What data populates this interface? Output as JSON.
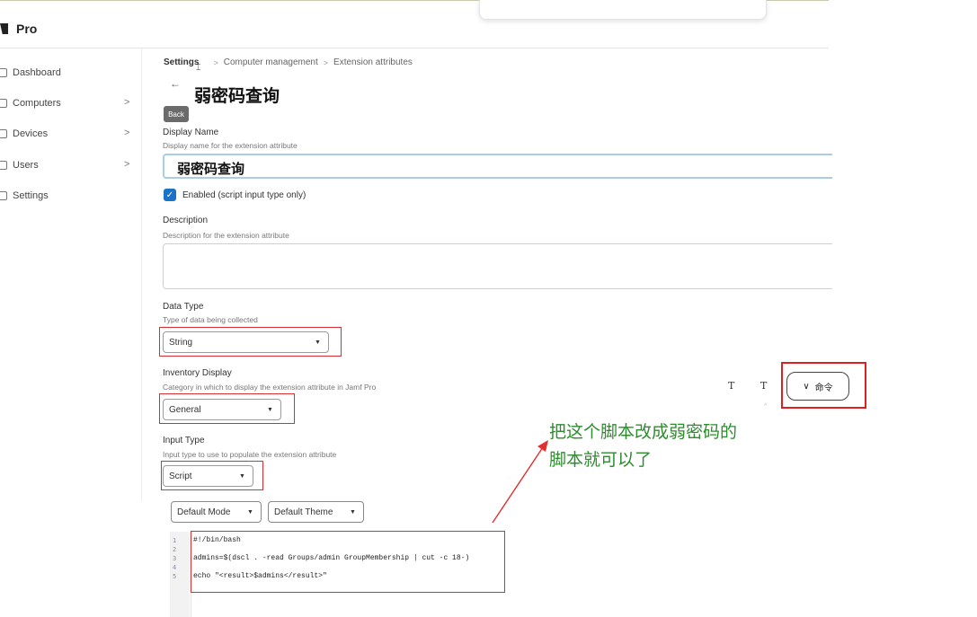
{
  "app": {
    "brand": "Pro"
  },
  "sidebar": {
    "items": [
      {
        "label": "Dashboard",
        "has_chevron": false,
        "chevron": ""
      },
      {
        "label": "Computers",
        "has_chevron": true,
        "chevron": ">"
      },
      {
        "label": "Devices",
        "has_chevron": true,
        "chevron": ">"
      },
      {
        "label": "Users",
        "has_chevron": true,
        "chevron": ">"
      },
      {
        "label": "Settings",
        "has_chevron": false,
        "chevron": ""
      }
    ]
  },
  "breadcrumb": {
    "items": [
      "Settings",
      "Computer management",
      "Extension attributes"
    ],
    "separator": ">"
  },
  "header": {
    "back_arrow": "←",
    "back_tooltip": "Back",
    "title": "弱密码查询"
  },
  "form": {
    "display_name": {
      "label": "Display Name",
      "hint": "Display name for the extension attribute",
      "value": "弱密码查询"
    },
    "enabled": {
      "checked": true,
      "label": "Enabled (script input type only)"
    },
    "description": {
      "label": "Description",
      "hint": "Description for the extension attribute",
      "value": ""
    },
    "data_type": {
      "label": "Data Type",
      "hint": "Type of data being collected",
      "value": "String"
    },
    "inventory_display": {
      "label": "Inventory Display",
      "hint": "Category in which to display the extension attribute in Jamf Pro",
      "value": "General"
    },
    "input_type": {
      "label": "Input Type",
      "hint": "Input type to use to populate the extension attribute",
      "value": "Script"
    }
  },
  "editor": {
    "mode": "Default Mode",
    "theme": "Default Theme",
    "line_numbers": [
      "1",
      "2",
      "3",
      "4",
      "5"
    ],
    "lines": [
      "#!/bin/bash",
      "",
      "admins=$(dscl . -read Groups/admin GroupMembership | cut -c 18-)",
      "",
      "echo \"<result>$admins</result>\""
    ]
  },
  "toolbar": {
    "icon1": "T",
    "icon2": "T",
    "command_label": "命令",
    "command_chevron": "∨"
  },
  "annotation": {
    "text_line1": "把这个脚本改成弱密码的",
    "text_line2": "脚本就可以了",
    "color": "#2e8b2e"
  },
  "colors": {
    "highlight_red": "#e02020",
    "checkbox_blue": "#1a73c7"
  }
}
